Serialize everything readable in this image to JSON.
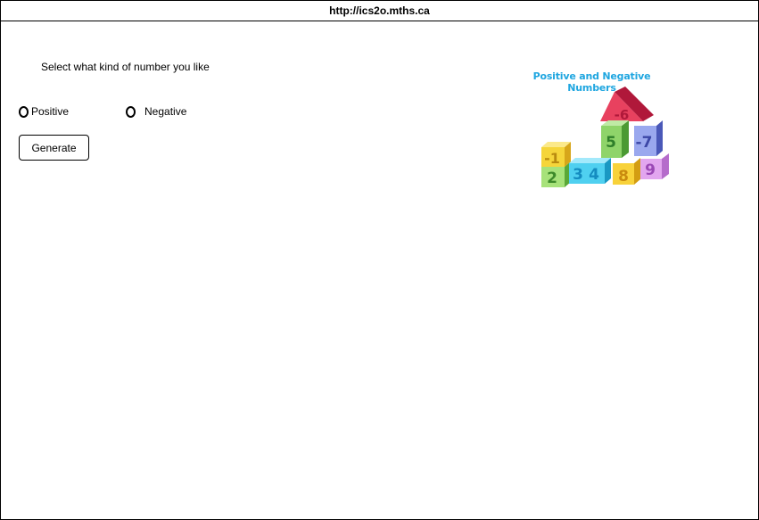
{
  "browser": {
    "url": "http://ics2o.mths.ca"
  },
  "form": {
    "prompt": "Select what kind of number you like",
    "options": [
      {
        "label": "Positive"
      },
      {
        "label": "Negative"
      }
    ],
    "generate_label": "Generate"
  },
  "illustration": {
    "title": "Positive and Negative Numbers",
    "blocks": [
      "-6",
      "5",
      "-7",
      "-1",
      "2",
      "3",
      "4",
      "8",
      "9"
    ],
    "icon": "number-blocks-illustration"
  }
}
